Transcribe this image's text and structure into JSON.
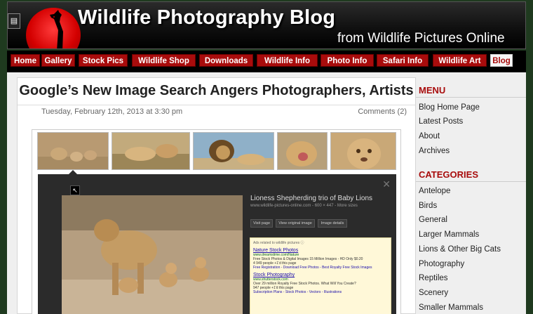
{
  "header": {
    "title": "Wildlife Photography Blog",
    "subtitle": "from Wildlife Pictures Online",
    "rss_icon": "rss-icon"
  },
  "nav": {
    "items": [
      {
        "label": "Home"
      },
      {
        "label": "Gallery"
      },
      {
        "label": "Stock Pics"
      },
      {
        "label": "Wildlife Shop"
      },
      {
        "label": "Downloads"
      },
      {
        "label": "Wildlife Info"
      },
      {
        "label": "Photo Info"
      },
      {
        "label": "Safari Info"
      },
      {
        "label": "Wildlife Art"
      },
      {
        "label": "Blog",
        "active": true
      }
    ]
  },
  "post": {
    "title": "Google’s New Image Search Angers Photographers, Artists",
    "date": "Tuesday, February 12th, 2013 at 3:30 pm",
    "comments": "Comments (2)"
  },
  "preview": {
    "title": "Lioness Shepherding trio of Baby Lions",
    "url": "www.wildlife-pictures-online.com - 600 × 447 - More sizes",
    "buttons": [
      "Visit page",
      "View original image",
      "Image details"
    ],
    "ads_header": "Ads related to wildlife pictures ⓘ",
    "ads": [
      {
        "headline": "Nature Stock Photos",
        "url": "www.dreamstime.com/Nature",
        "desc": "Free Stock Photos & Digital Images 15 Million Images - HD Only $0.20",
        "social": "4 949 people +1'd this page",
        "links": "Free Registration - Download Free Photos - Best Royalty Free Stock Images"
      },
      {
        "headline": "Stock Photography",
        "url": "www.shutterstock.com",
        "desc": "Over 29 million Royalty Free Stock Photos. What Will You Create?",
        "social": "947 people +1'd this page",
        "links": "Subscription Plans - Stock Photos - Vectors - Illustrations"
      }
    ]
  },
  "sidebar": {
    "menu_title": "MENU",
    "menu": [
      "Blog Home Page",
      "Latest Posts",
      "About",
      "Archives"
    ],
    "categories_title": "CATEGORIES",
    "categories": [
      "Antelope",
      "Birds",
      "General",
      "Larger Mammals",
      "Lions & Other Big Cats",
      "Photography",
      "Reptiles",
      "Scenery",
      "Smaller Mammals"
    ]
  },
  "colors": {
    "accent_red": "#a80c0c",
    "page_bg": "#1f3a1f",
    "header_bg": "#000000"
  }
}
